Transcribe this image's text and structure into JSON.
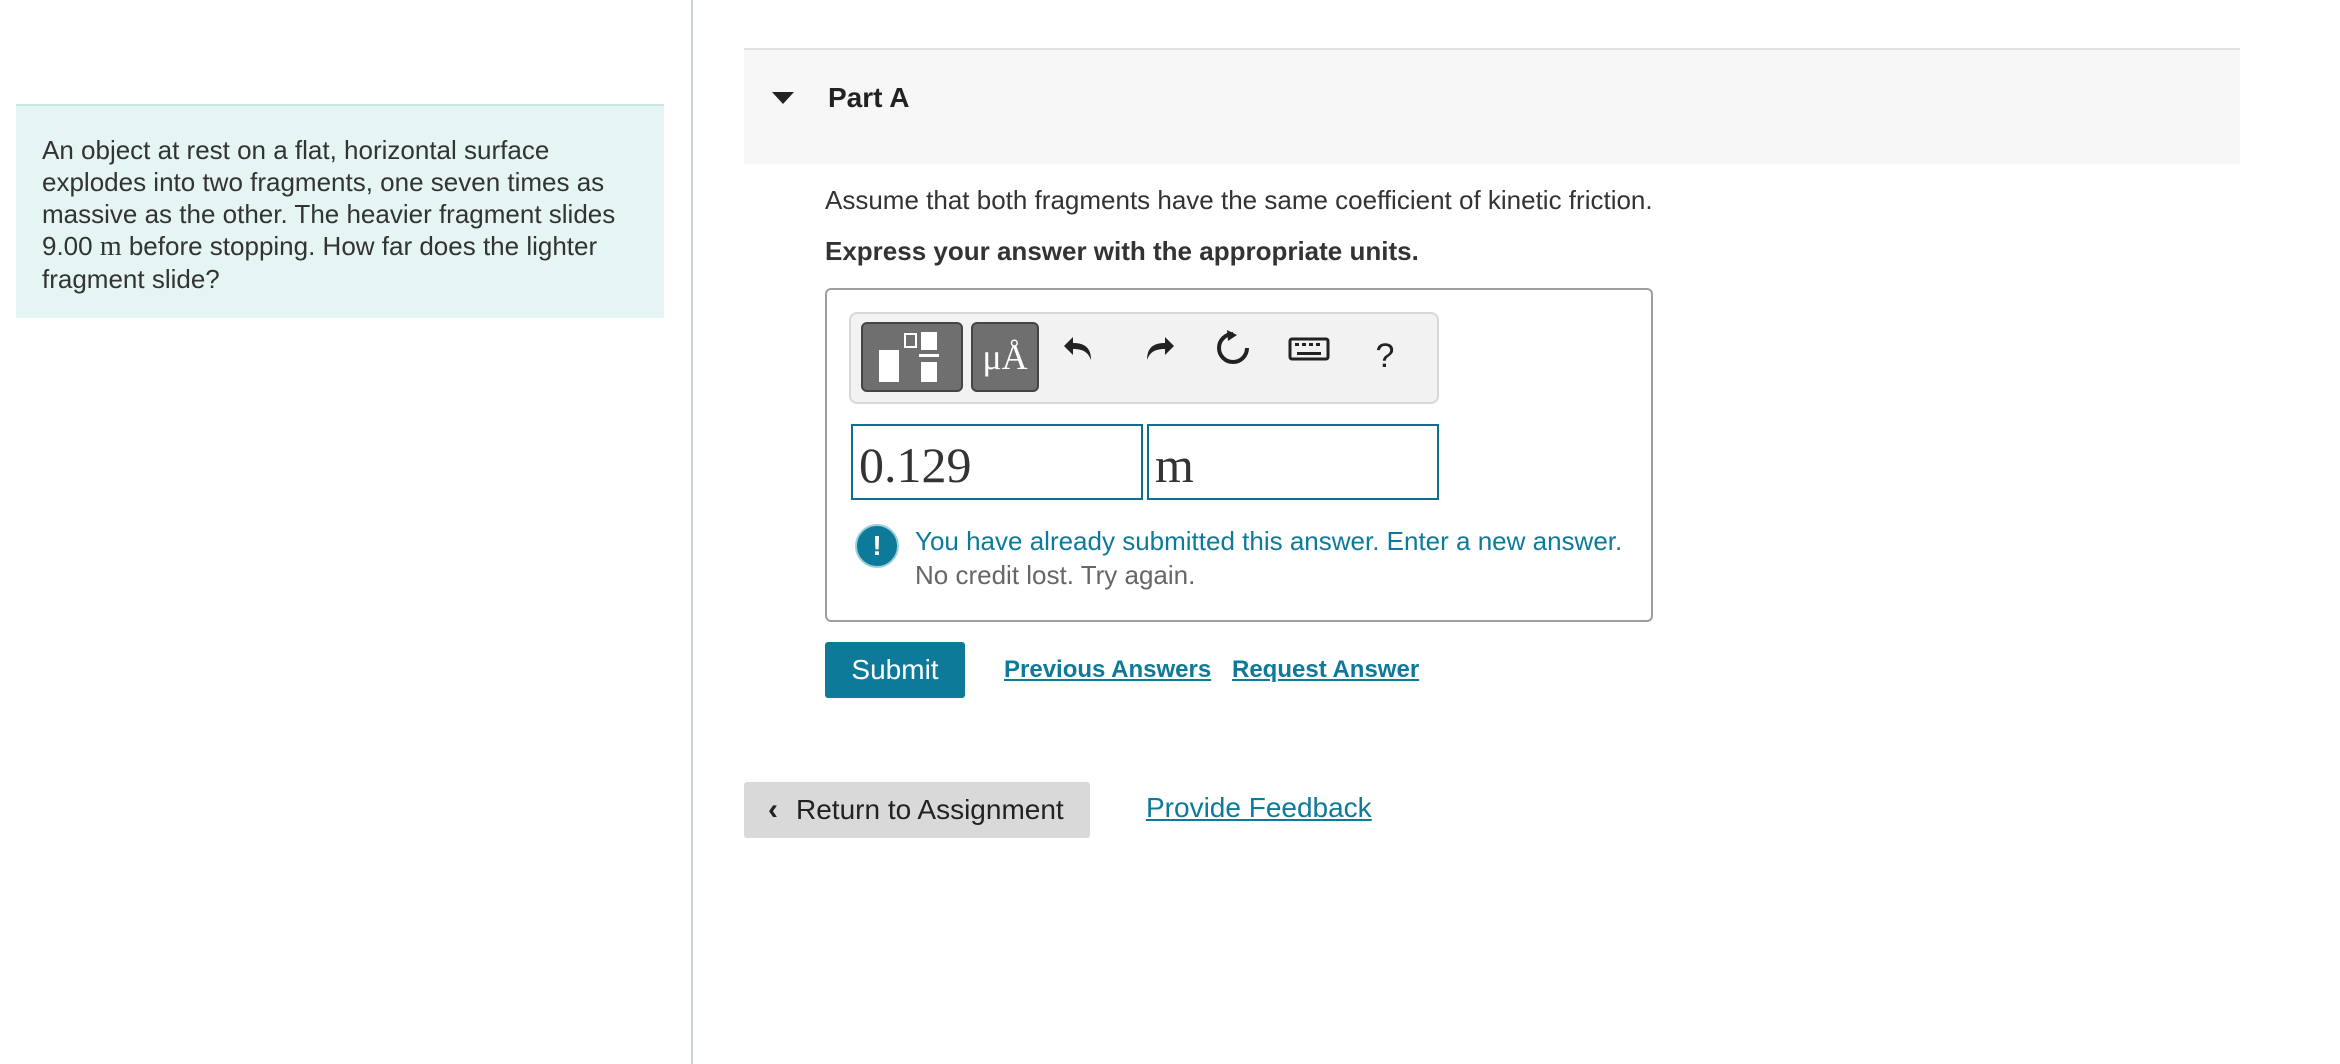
{
  "problem": {
    "text_before": "An object at rest on a flat, horizontal surface explodes into two fragments, one seven times as massive as the other. The heavier fragment slides ",
    "distance": "9.00",
    "unit": "m",
    "text_after": " before stopping. How far does the lighter fragment slide?"
  },
  "part": {
    "title": "Part A"
  },
  "instruction": "Assume that both fragments have the same coefficient of kinetic friction.",
  "express": "Express your answer with the appropriate units.",
  "toolbar": {
    "units_label": "μÅ",
    "help_label": "?"
  },
  "answer": {
    "value": "0.129",
    "unit": "m"
  },
  "alert": {
    "icon": "!",
    "message": "You have already submitted this answer. Enter a new answer.",
    "sub": "No credit lost. Try again."
  },
  "actions": {
    "submit": "Submit",
    "previous_answers": "Previous Answers",
    "request_answer": "Request Answer"
  },
  "footer": {
    "return": "Return to Assignment",
    "feedback": "Provide Feedback"
  },
  "colors": {
    "accent": "#0e7a9a",
    "problem_bg": "#e5f5f4"
  }
}
